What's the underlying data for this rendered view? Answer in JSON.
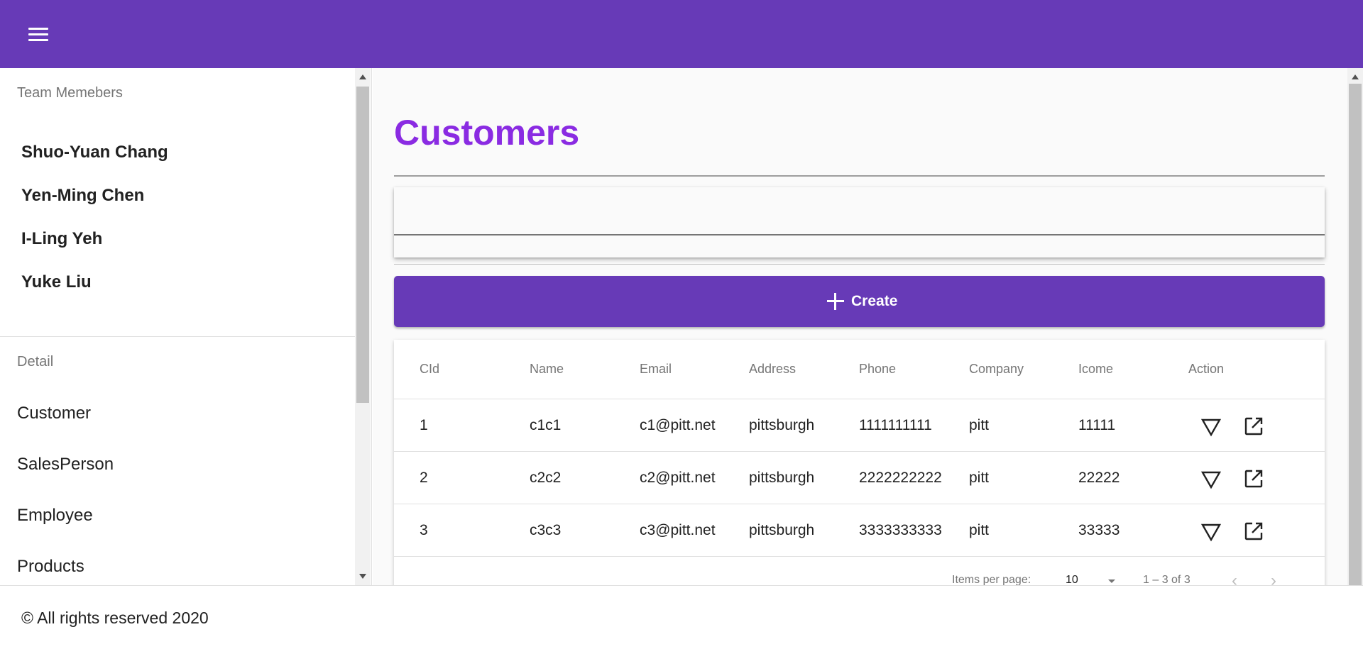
{
  "header": {
    "menu_icon": "menu-icon"
  },
  "sidebar": {
    "team_header": "Team Memebers",
    "members": [
      "Shuo-Yuan Chang",
      "Yen-Ming Chen",
      "I-Ling Yeh",
      "Yuke Liu"
    ],
    "detail_header": "Detail",
    "nav": [
      "Customer",
      "SalesPerson",
      "Employee",
      "Products"
    ]
  },
  "main": {
    "title": "Customers",
    "search": {
      "value": "",
      "placeholder": ""
    },
    "create_label": "Create",
    "table": {
      "columns": [
        "CId",
        "Name",
        "Email",
        "Address",
        "Phone",
        "Company",
        "Icome",
        "Action"
      ],
      "rows": [
        [
          "1",
          "c1c1",
          "c1@pitt.net",
          "pittsburgh",
          "1111111111",
          "pitt",
          "11111"
        ],
        [
          "2",
          "c2c2",
          "c2@pitt.net",
          "pittsburgh",
          "2222222222",
          "pitt",
          "22222"
        ],
        [
          "3",
          "c3c3",
          "c3@pitt.net",
          "pittsburgh",
          "3333333333",
          "pitt",
          "33333"
        ]
      ]
    },
    "paginator": {
      "label": "Items per page:",
      "page_size": "10",
      "range": "1 – 3 of 3"
    }
  },
  "footer": {
    "text": "© All rights reserved 2020"
  },
  "colors": {
    "primary": "#673ab7",
    "title": "#8a2be2"
  }
}
